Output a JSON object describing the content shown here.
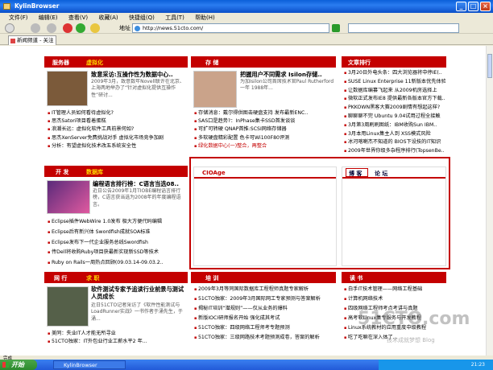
{
  "window": {
    "title": "KylinBrowser"
  },
  "menu": [
    "文件(F)",
    "编辑(E)",
    "查看(V)",
    "收藏(A)",
    "快捷组(Q)",
    "工具(T)",
    "帮助(H)"
  ],
  "toolbar": {
    "address_label": "地址",
    "url": "http://news.51cto.com/"
  },
  "tab": {
    "label": "新闻频道 - 关注"
  },
  "sec1": {
    "h1": "服务器",
    "h2": "虚拟化",
    "title": "致意采访:互操作性为数据中心..",
    "summary": "2009年3月，致意数年Novell联许在北京、上海两地举办了“针对虚拟化提供互操作性”研讨...",
    "items": [
      "IT管理人员如何看待虚拟化?",
      "思杰Satori项目看着蛋糕",
      "浪潮长远：虚拟化软件工具前景何如?",
      "思杰XenServer免费挑战对手 虚拟化市场竞争加剧",
      "分析：有望虚拟化技术改五系统安全性"
    ]
  },
  "sec2": {
    "h1": "存 储",
    "title": "把握用户不同需求 Isilon存储..",
    "summary": "为加Isilon公司首席技术官Paul Rutherford一年 1988年...",
    "items": [
      "存储消息：戴尔得供图击硬盘支持 发布最新ENC..",
      "SAS口是趋势?：InPhase集卡SSD首发谈谈",
      "可扩可转硬 QNAP首推:SCSI网络存储器",
      "多软硬盘精彩配置 色卡可Wi100F80评测",
      "绿化数据中心(一)整合，再整合"
    ]
  },
  "sec3": {
    "h1": "文章排行",
    "items": [
      "3月20日外电头条：四大浏览器将中停IE(..",
      "SUSE Linux Enterprise 11新版本优先体验",
      "让数据库编纂飞起来 从2009机房选择上",
      "微软正式发布IE8 提供最新各版本官方下载..",
      "PKKOWN黑客大赛2009剧情有想起这样?",
      "聊聊聊不完 Ubuntu 9.04试用过程全接触",
      "3月第3周刷刷图纸：IBM收购Sun IBM..",
      "3月本用Linux集主人到 XSS模式风险",
      "冰河喀喇杰不知道的 BIOS下设技的IT知识",
      "2009年世界你级多杂程序排行(TopsenBe.."
    ]
  },
  "sec4": {
    "h1": "开 发",
    "h2": "数据库",
    "title": "编程语言排行榜：C语言当选08..",
    "summary": "近日公告2009年1月TIOBE编程语言排行榜，C语言获当选为2008年的年度编程语言。",
    "items": [
      "Eclipse插件WebWire 1.0发布 极大方便代码编辑",
      "Eclipse后有新兴体 Swordfish成就SOA标准",
      "Eclipse发布下一代企业服务总线Swordfish",
      "传Dell将收购Ruby项目获最新实现新SSD等技术",
      "Ruby on Rails一周热点回顾(09.03.14-09.03.2.."
    ]
  },
  "sec5": {
    "h1": "CIOAge"
  },
  "sec6": {
    "h1": "博 客",
    "h2": "论 坛"
  },
  "sec7": {
    "h1": "网 行",
    "h2": "求 职",
    "title": "软件测试专家予追读行业前景与测试人员成长",
    "summary": "近日51CTO记者采访了《软件性能测试与LoadRunner实战》一书作者于涌先生，于涌...",
    "items": [
      "美同：失业IT人才能无所寻业",
      "51CTO独家：IT外包业行业工薪水平2 年..."
    ]
  },
  "sec8": {
    "h1": "培 训",
    "items": [
      "2009年3月等同国际数据库工程程师真题专家解析",
      "51CTO独家：2009年3月国际网工专家预测与答案解析",
      "揭秘IT培训“潜规则”——仅从业务的爆料",
      "新版IOCI研师报名开始 强化成其考试",
      "51CTO独家：四级网络工程师考专题预测",
      "51CTO独家：三级网路技术考题预测成卷，答案的解析"
    ]
  },
  "sec9": {
    "h1": "读 书",
    "items": [
      "白手IT技术管理——网络工程基础",
      "计算机网络技术",
      "四级网络工程师考点考讲与真题",
      "高考软Linux集专服务与开发教程",
      "Linux系统教材的应用重度中级教程",
      "吃了吃嘛在深入体了..."
    ]
  },
  "status": {
    "text": "完成"
  },
  "taskbar": {
    "start": "开始",
    "task": "KylinBrowser",
    "clock": "21:23"
  },
  "watermark": {
    "text": "51CTO.com",
    "sub": "技术成就梦想 Blog"
  }
}
